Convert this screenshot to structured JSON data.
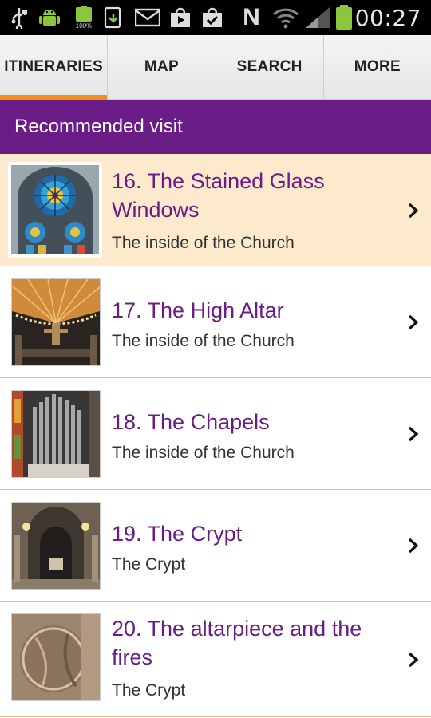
{
  "status_bar": {
    "time": "00:27",
    "icons": [
      "usb-icon",
      "android-icon",
      "battery-full-small-icon",
      "download-icon",
      "email-icon",
      "play-store-icon",
      "tasks-check-icon",
      "nfc-icon",
      "wifi-icon",
      "signal-icon",
      "battery-icon"
    ],
    "battery_small_label": "100%",
    "nfc_label": "N"
  },
  "tabs": [
    {
      "label": "ITINERARIES",
      "active": true
    },
    {
      "label": "MAP",
      "active": false
    },
    {
      "label": "SEARCH",
      "active": false
    },
    {
      "label": "MORE",
      "active": false
    }
  ],
  "header": {
    "title": "Recommended visit"
  },
  "items": [
    {
      "title": "16. The Stained Glass Windows",
      "subtitle": "The inside of the Church",
      "selected": true,
      "thumb": "stained-glass"
    },
    {
      "title": "17. The High Altar",
      "subtitle": "The inside of the Church",
      "selected": false,
      "thumb": "high-altar"
    },
    {
      "title": "18. The Chapels",
      "subtitle": "The inside of the Church",
      "selected": false,
      "thumb": "chapels"
    },
    {
      "title": "19. The Crypt",
      "subtitle": "The Crypt",
      "selected": false,
      "thumb": "crypt"
    },
    {
      "title": "20. The altarpiece and the fires",
      "subtitle": "The Crypt",
      "selected": false,
      "thumb": "altarpiece"
    }
  ],
  "colors": {
    "accent": "#6a1d86",
    "tab_indicator": "#f28f16",
    "selected_row": "#fde9cb",
    "divider": "#e7b98c"
  }
}
